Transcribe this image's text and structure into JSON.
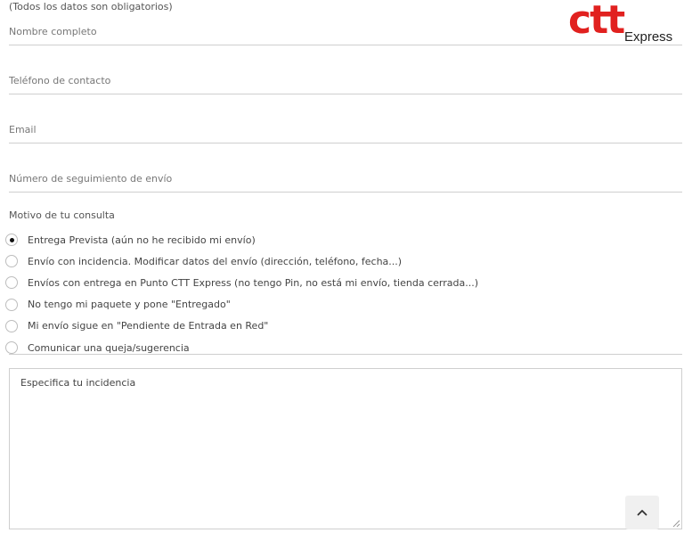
{
  "form": {
    "required_note": "(Todos los datos son obligatorios)",
    "fields": {
      "name": {
        "placeholder": "Nombre completo",
        "value": ""
      },
      "phone": {
        "placeholder": "Teléfono de contacto",
        "value": ""
      },
      "email": {
        "placeholder": "Email",
        "value": ""
      },
      "tracking": {
        "placeholder": "Número de seguimiento de envío",
        "value": ""
      }
    },
    "reason_title": "Motivo de tu consulta",
    "reasons": [
      {
        "label": "Entrega Prevista (aún no he recibido mi envío)",
        "checked": true
      },
      {
        "label": "Envío con incidencia. Modificar datos del envío (dirección, teléfono, fecha...)",
        "checked": false
      },
      {
        "label": "Envíos con entrega en Punto CTT Express (no tengo Pin, no está mi envío, tienda cerrada...)",
        "checked": false
      },
      {
        "label": "No tengo mi paquete y pone \"Entregado\"",
        "checked": false
      },
      {
        "label": "Mi envío sigue en \"Pendiente de Entrada en Red\"",
        "checked": false
      },
      {
        "label": "Comunicar una queja/sugerencia",
        "checked": false
      }
    ],
    "incident": {
      "placeholder": "Especifica tu incidencia",
      "value": ""
    }
  },
  "logo": {
    "ctt": "ctt",
    "express": "Express",
    "brand_color": "#e1211f"
  },
  "icons": {
    "scroll_top": "chevron-up-icon"
  }
}
